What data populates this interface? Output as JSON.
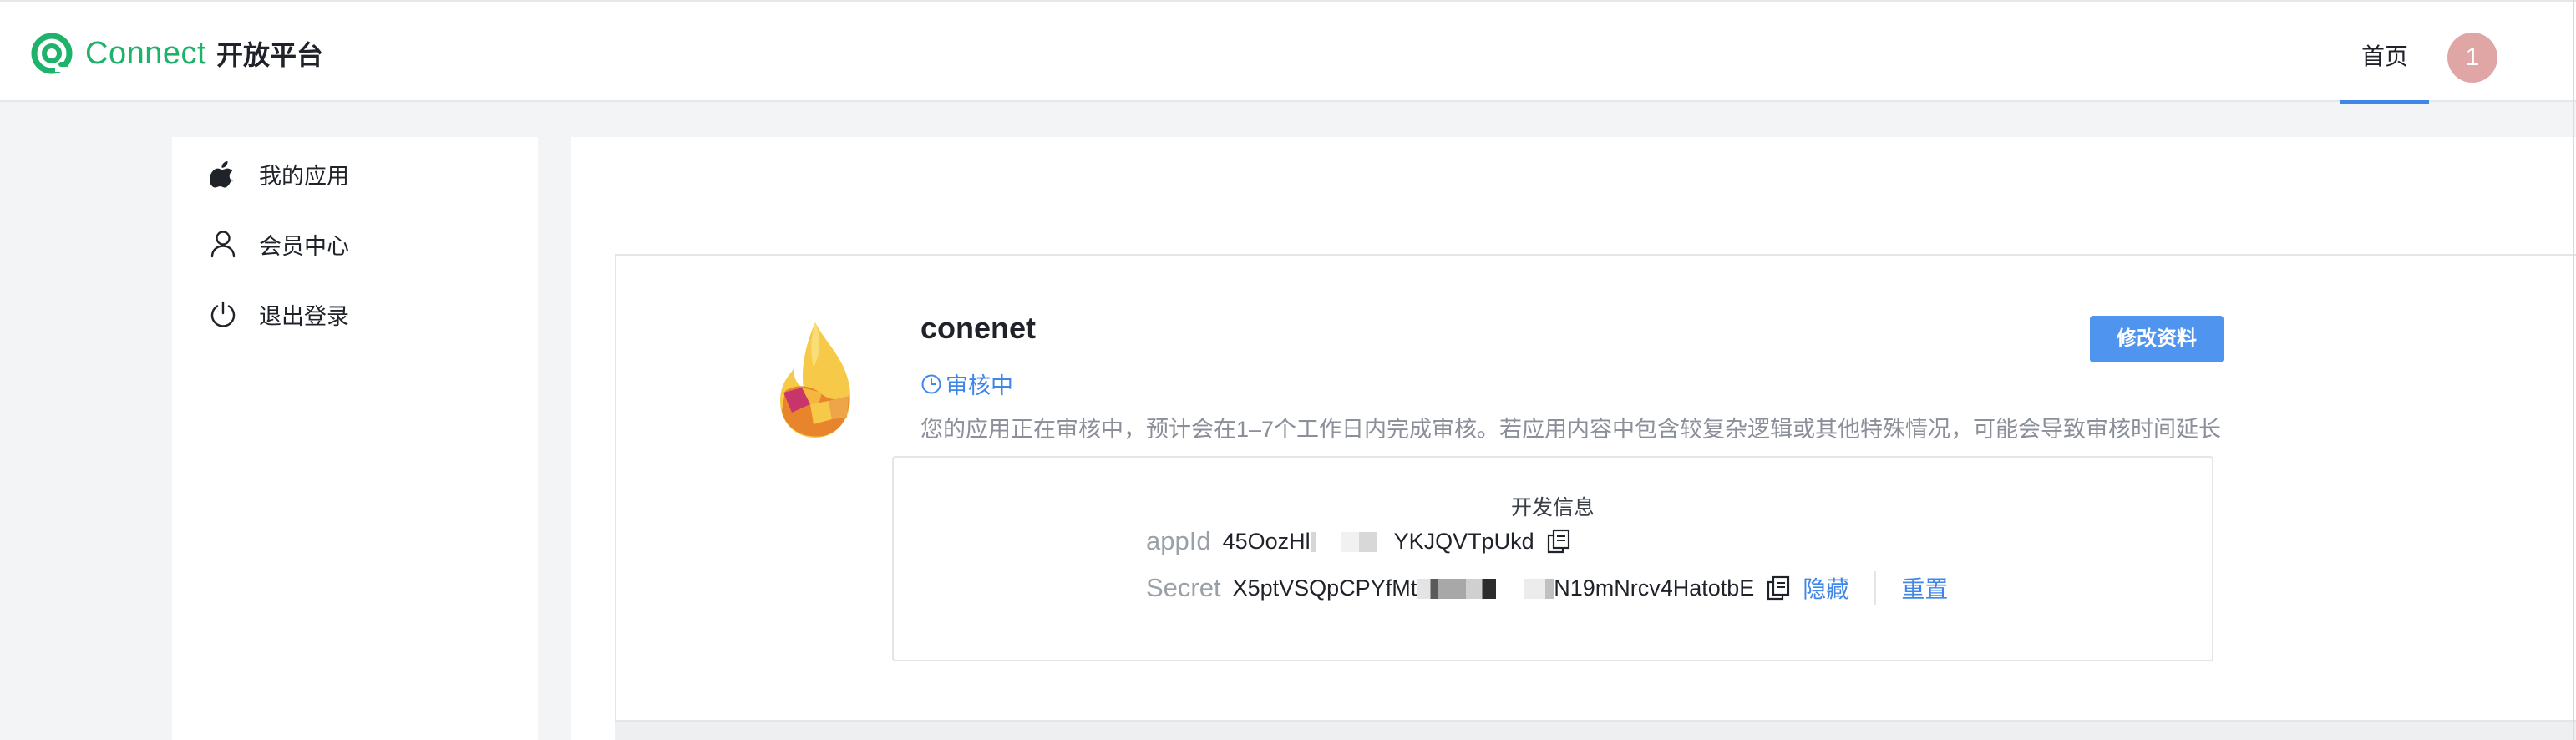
{
  "header": {
    "brand": "Connect",
    "brand_sub": "开放平台",
    "nav_home": "首页",
    "avatar_text": "1",
    "accent": "#1fb26b"
  },
  "sidebar": {
    "items": [
      {
        "label": "我的应用",
        "icon": "apple-icon"
      },
      {
        "label": "会员中心",
        "icon": "user-icon"
      },
      {
        "label": "退出登录",
        "icon": "power-icon"
      }
    ]
  },
  "app": {
    "name": "conenet",
    "status": "审核中",
    "description": "您的应用正在审核中，预计会在1–7个工作日内完成审核。若应用内容中包含较复杂逻辑或其他特殊情况，可能会导致审核时间延长",
    "edit_button": "修改资料"
  },
  "dev_info": {
    "title": "开发信息",
    "appid_label": "appId",
    "appid_prefix": "45OozHl",
    "appid_suffix": "YKJQVTpUkd",
    "secret_label": "Secret",
    "secret_prefix": "X5ptVSQpCPYfMt",
    "secret_suffix": "N19mNrcv4HatotbE",
    "hide_label": "隐藏",
    "reset_label": "重置",
    "link_color": "#3f86e8"
  }
}
